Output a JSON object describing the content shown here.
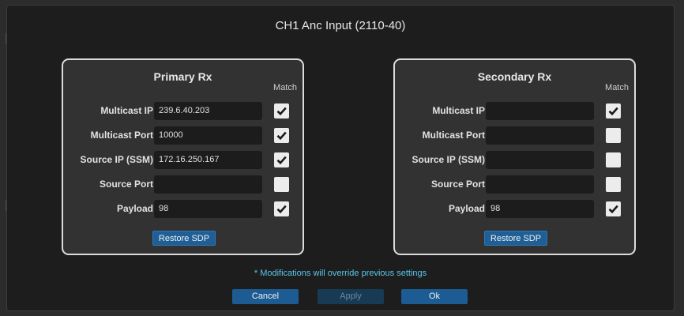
{
  "dialog": {
    "title": "CH1 Anc Input (2110-40)",
    "notice": "* Modifications will override previous settings"
  },
  "match_header": "Match",
  "primary": {
    "title": "Primary Rx",
    "restore_label": "Restore SDP",
    "rows": [
      {
        "label": "Multicast IP",
        "value": "239.6.40.203",
        "checked": true
      },
      {
        "label": "Multicast Port",
        "value": "10000",
        "checked": true
      },
      {
        "label": "Source IP (SSM)",
        "value": "172.16.250.167",
        "checked": true
      },
      {
        "label": "Source Port",
        "value": "",
        "checked": false
      },
      {
        "label": "Payload",
        "value": "98",
        "checked": true
      }
    ]
  },
  "secondary": {
    "title": "Secondary Rx",
    "restore_label": "Restore SDP",
    "rows": [
      {
        "label": "Multicast IP",
        "value": "",
        "checked": true
      },
      {
        "label": "Multicast Port",
        "value": "",
        "checked": false
      },
      {
        "label": "Source IP (SSM)",
        "value": "",
        "checked": false
      },
      {
        "label": "Source Port",
        "value": "",
        "checked": false
      },
      {
        "label": "Payload",
        "value": "98",
        "checked": true
      }
    ]
  },
  "buttons": {
    "cancel": "Cancel",
    "apply": "Apply",
    "ok": "Ok"
  },
  "colors": {
    "accent": "#1c5c93",
    "notice": "#59c7ec",
    "checkbox": "#ececec"
  },
  "icons": {
    "check": "checkmark-icon"
  }
}
